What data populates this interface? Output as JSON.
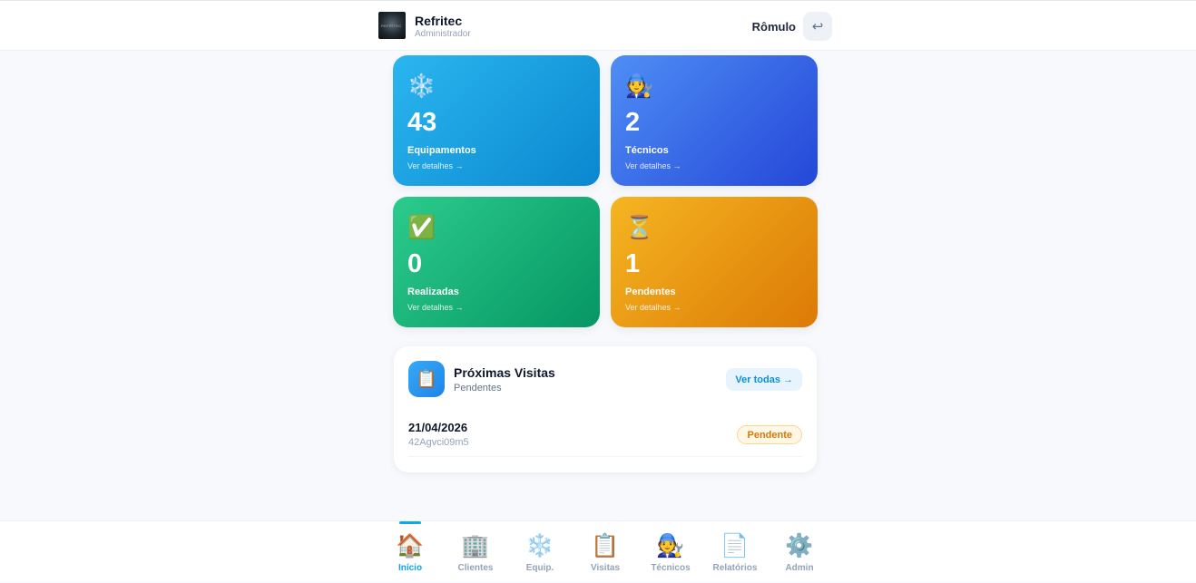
{
  "header": {
    "brand_name": "Refritec",
    "brand_role": "Administrador",
    "user_name": "Rômulo",
    "logout_icon": "↩"
  },
  "stats": [
    {
      "icon": "❄️",
      "icon_name": "snowflake-icon",
      "value": "43",
      "label": "Equipamentos",
      "link": "Ver detalhes →"
    },
    {
      "icon": "🧑‍🔧",
      "icon_name": "technician-icon",
      "value": "2",
      "label": "Técnicos",
      "link": "Ver detalhes →"
    },
    {
      "icon": "✅",
      "icon_name": "check-icon",
      "value": "0",
      "label": "Realizadas",
      "link": "Ver detalhes →"
    },
    {
      "icon": "⏳",
      "icon_name": "hourglass-icon",
      "value": "1",
      "label": "Pendentes",
      "link": "Ver detalhes →"
    }
  ],
  "visits": {
    "icon": "📋",
    "title": "Próximas Visitas",
    "subtitle": "Pendentes",
    "see_all": "Ver todas →",
    "items": [
      {
        "date": "21/04/2026",
        "code": "42Agvci09m5",
        "status": "Pendente"
      }
    ]
  },
  "nav": [
    {
      "icon": "🏠",
      "label": "Início",
      "active": true
    },
    {
      "icon": "🏢",
      "label": "Clientes",
      "active": false
    },
    {
      "icon": "❄️",
      "label": "Equip.",
      "active": false
    },
    {
      "icon": "📋",
      "label": "Visitas",
      "active": false
    },
    {
      "icon": "🧑‍🔧",
      "label": "Técnicos",
      "active": false
    },
    {
      "icon": "📄",
      "label": "Relatórios",
      "active": false
    },
    {
      "icon": "⚙️",
      "label": "Admin",
      "active": false
    }
  ],
  "colors": {
    "accent": "#0ea5e9",
    "equipamentos": "#1aa0e2",
    "tecnicos": "#3a6de8",
    "realizadas": "#18b47a",
    "pendentes": "#eb9a14",
    "badge_pending": "#d97706"
  }
}
